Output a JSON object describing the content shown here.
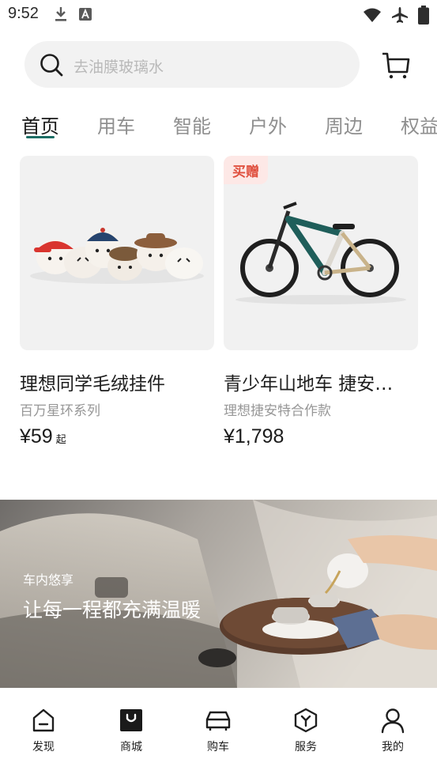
{
  "status_bar": {
    "time": "9:52",
    "left_icons": [
      "download-icon",
      "a-badge-icon"
    ],
    "right_icons": [
      "wifi-icon",
      "airplane-icon",
      "battery-icon"
    ]
  },
  "search": {
    "placeholder": "去油膜玻璃水",
    "search_icon": "search-icon",
    "cart_icon": "cart-icon"
  },
  "tabs": [
    {
      "label": "首页",
      "active": true
    },
    {
      "label": "用车",
      "active": false
    },
    {
      "label": "智能",
      "active": false
    },
    {
      "label": "户外",
      "active": false
    },
    {
      "label": "周边",
      "active": false
    },
    {
      "label": "权益",
      "active": false
    }
  ],
  "products": [
    {
      "image": "plush-keychains-image",
      "title": "理想同学毛绒挂件",
      "subtitle": "百万星环系列",
      "price": "¥59",
      "price_suffix": "起",
      "badge": ""
    },
    {
      "image": "kids-mountain-bike-image",
      "title": "青少年山地车 捷安…",
      "subtitle": "理想捷安特合作款",
      "price": "¥1,798",
      "price_suffix": "",
      "badge": "买赠"
    }
  ],
  "banner": {
    "subtitle": "车内悠享",
    "title": "让每一程都充满温暖"
  },
  "bottom_nav": [
    {
      "label": "发现",
      "icon": "discover-icon",
      "active": false
    },
    {
      "label": "商城",
      "icon": "mall-icon",
      "active": true
    },
    {
      "label": "购车",
      "icon": "car-icon",
      "active": false
    },
    {
      "label": "服务",
      "icon": "service-icon",
      "active": false
    },
    {
      "label": "我的",
      "icon": "profile-icon",
      "active": false
    }
  ],
  "colors": {
    "accent": "#1c6d64",
    "badge_bg": "#fde8e6",
    "badge_text": "#e0503f",
    "search_bg": "#f2f2f2",
    "placeholder": "#b9b9b9"
  }
}
